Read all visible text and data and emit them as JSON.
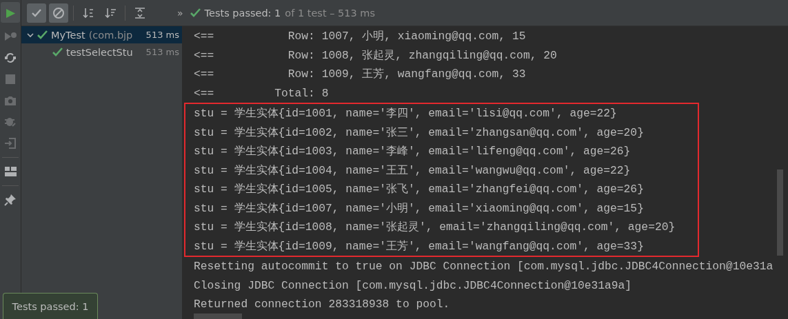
{
  "toolbar": {
    "run_button": {
      "label": "▶"
    },
    "buttons": [
      {
        "kind": "check",
        "selected": true
      },
      {
        "kind": "ignore",
        "selected": true
      },
      {
        "kind": "sort-alpha",
        "selected": false
      },
      {
        "kind": "sort-time",
        "selected": false
      },
      {
        "kind": "expand",
        "selected": false
      }
    ],
    "more": "»",
    "status": {
      "passed": true,
      "main": "Tests passed: 1",
      "detail": "of 1 test – 513 ms"
    }
  },
  "side_tools": [
    {
      "kind": "rerun-failed",
      "disabled": true
    },
    {
      "kind": "toggle-auto",
      "disabled": false
    },
    {
      "kind": "stop",
      "disabled": true
    },
    {
      "kind": "camera",
      "disabled": true
    },
    {
      "kind": "bug",
      "disabled": true
    },
    {
      "kind": "import",
      "disabled": true
    },
    {
      "kind": "layout",
      "disabled": false
    },
    {
      "kind": "pin",
      "disabled": false
    }
  ],
  "tree": [
    {
      "name": "MyTest",
      "detail": "(com.bjp",
      "time": "513 ms",
      "passed": true,
      "selected": true,
      "expanded": true,
      "children": [
        {
          "name": "testSelectStu",
          "time": "513 ms",
          "passed": true,
          "selected": false
        }
      ]
    }
  ],
  "console": {
    "lines_before": [
      {
        "prefix": "<==",
        "text": "     Row: 1007, 小明, xiaoming@qq.com, 15"
      },
      {
        "prefix": "<==",
        "text": "     Row: 1008, 张起灵, zhangqiling@qq.com, 20"
      },
      {
        "prefix": "<==",
        "text": "     Row: 1009, 王芳, wangfang@qq.com, 33"
      },
      {
        "prefix": "<==",
        "text": "   Total: 8"
      }
    ],
    "highlighted_lines": [
      "stu = 学生实体{id=1001, name='李四', email='lisi@qq.com', age=22}",
      "stu = 学生实体{id=1002, name='张三', email='zhangsan@qq.com', age=20}",
      "stu = 学生实体{id=1003, name='李峰', email='lifeng@qq.com', age=26}",
      "stu = 学生实体{id=1004, name='王五', email='wangwu@qq.com', age=22}",
      "stu = 学生实体{id=1005, name='张飞', email='zhangfei@qq.com', age=26}",
      "stu = 学生实体{id=1007, name='小明', email='xiaoming@qq.com', age=15}",
      "stu = 学生实体{id=1008, name='张起灵', email='zhangqiling@qq.com', age=20}",
      "stu = 学生实体{id=1009, name='王芳', email='wangfang@qq.com', age=33}"
    ],
    "lines_after": [
      "Resetting autocommit to true on JDBC Connection [com.mysql.jdbc.JDBC4Connection@10e31a",
      "Closing JDBC Connection [com.mysql.jdbc.JDBC4Connection@10e31a9a]",
      "Returned connection 283318938 to pool."
    ]
  },
  "toast": {
    "text": "Tests passed: 1"
  }
}
